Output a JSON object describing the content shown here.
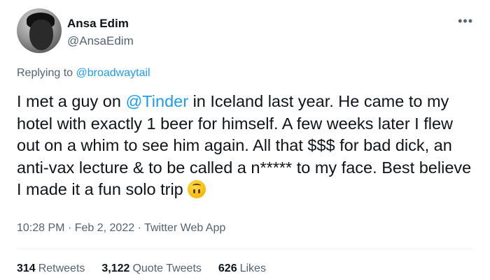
{
  "author": {
    "name": "Ansa Edim",
    "handle": "@AnsaEdim"
  },
  "more_icon": "more-horizontal-icon",
  "replying": {
    "prefix": "Replying to",
    "mention": "@broadwaytail"
  },
  "tweet": {
    "text_before": "I met a guy on ",
    "mention": "@Tinder",
    "text_after": " in Iceland last year. He came to my hotel with exactly 1 beer for himself. A few weeks later I flew out on a whim to see him again. All that $$$ for bad dick, an anti-vax lecture & to be called a n***** to my face. Best believe I made it a fun solo trip",
    "emoji": "upside-down-face-emoji"
  },
  "meta": {
    "time": "10:28 PM",
    "date": "Feb 2, 2022",
    "source": "Twitter Web App",
    "separator": "·"
  },
  "stats": {
    "retweets_count": "314",
    "retweets_label": "Retweets",
    "quotes_count": "3,122",
    "quotes_label": "Quote Tweets",
    "likes_count": "626",
    "likes_label": "Likes"
  },
  "colors": {
    "accent": "#1d9bf0",
    "secondary_text": "#536471",
    "primary_text": "#0f1419"
  }
}
